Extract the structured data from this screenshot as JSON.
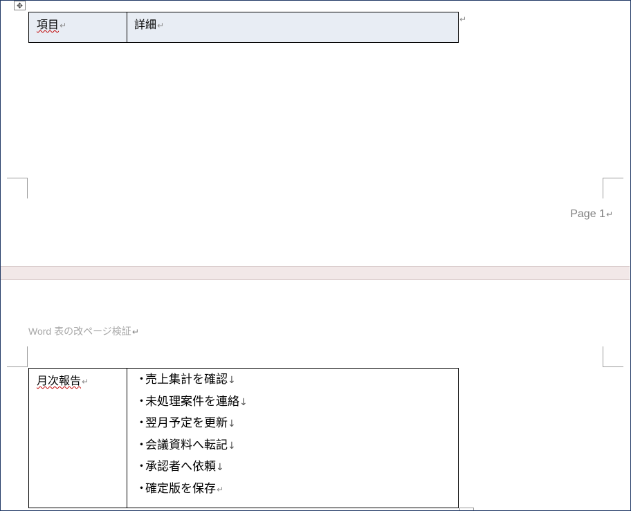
{
  "page1": {
    "table": {
      "header_col1": "項目",
      "header_col2": "詳細"
    },
    "footer": "Page 1"
  },
  "page2": {
    "header": "Word 表の改ページ検証",
    "table": {
      "label": "月次報告",
      "items": [
        "売上集計を確認",
        "未処理案件を連絡",
        "翌月予定を更新",
        "会議資料へ転記",
        "承認者へ依頼",
        "確定版を保存"
      ]
    }
  },
  "marks": {
    "cell_end": "↵",
    "paragraph": "↵",
    "line_break": "↓",
    "bullet": "・"
  }
}
